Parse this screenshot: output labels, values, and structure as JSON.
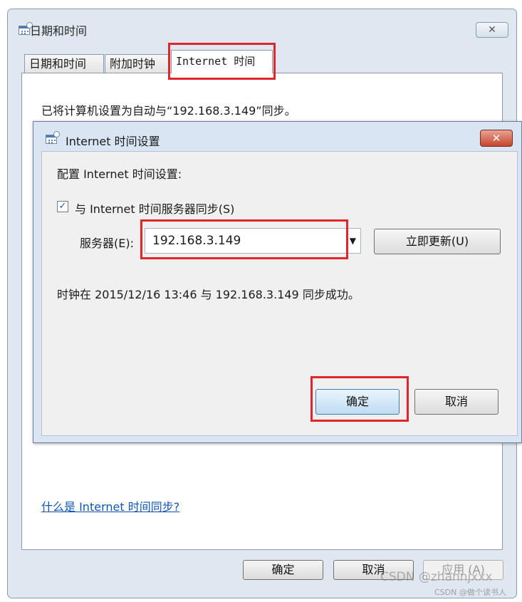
{
  "outer_dialog": {
    "title": "日期和时间",
    "close_icon": "close-icon",
    "tabs": [
      {
        "label": "日期和时间"
      },
      {
        "label": "附加时钟"
      },
      {
        "label": "Internet 时间"
      }
    ],
    "status_text": "已将计算机设置为自动与“192.168.3.149”同步。",
    "help_link": "什么是 Internet 时间同步?",
    "buttons": {
      "ok": "确定",
      "cancel": "取消",
      "apply": "应用 (A)"
    }
  },
  "inner_dialog": {
    "title": "Internet 时间设置",
    "close_icon": "close-icon",
    "heading": "配置 Internet 时间设置:",
    "sync_checkbox": {
      "label": "与 Internet 时间服务器同步(S)",
      "checked": true
    },
    "server_label": "服务器(E):",
    "server_value": "192.168.3.149",
    "update_now": "立即更新(U)",
    "sync_status": "时钟在 2015/12/16 13:46 与 192.168.3.149 同步成功。",
    "buttons": {
      "ok": "确定",
      "cancel": "取消"
    }
  },
  "watermark": {
    "main": "CSDN @zhannjxxx",
    "sub": "CSDN @做个读书人"
  },
  "colors": {
    "highlight": "#e0252b",
    "link": "#0f55b5",
    "close_red": "#c4452d"
  }
}
